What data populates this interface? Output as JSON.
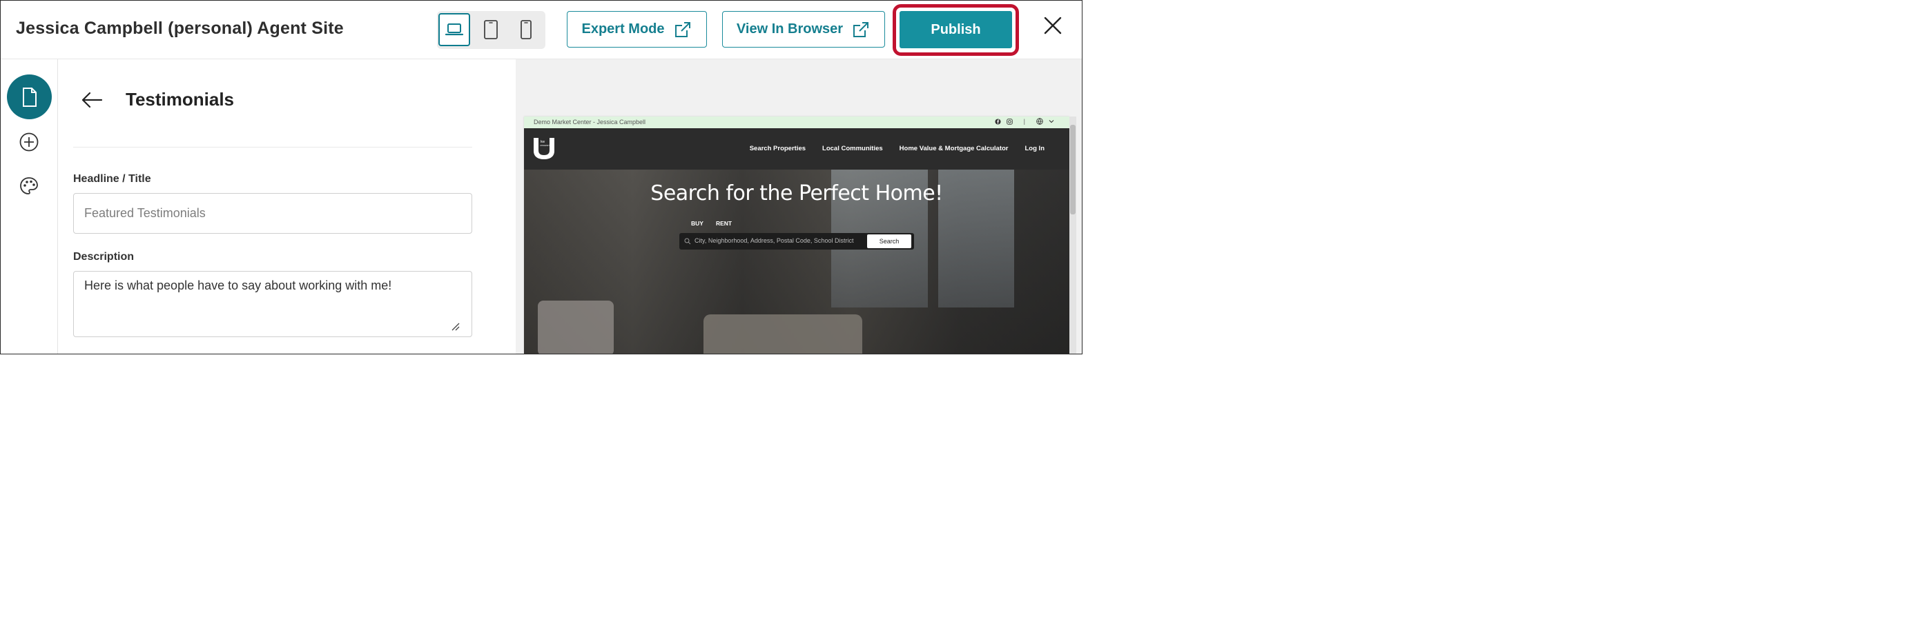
{
  "header": {
    "site_title": "Jessica Campbell (personal) Agent Site",
    "expert_mode_label": "Expert Mode",
    "view_in_browser_label": "View In Browser",
    "publish_label": "Publish",
    "device_modes": [
      "desktop",
      "tablet",
      "mobile"
    ],
    "active_device": "desktop"
  },
  "rail": {
    "items": [
      {
        "icon": "page-icon",
        "active": true
      },
      {
        "icon": "add-circle-icon",
        "active": false
      },
      {
        "icon": "palette-icon",
        "active": false
      }
    ]
  },
  "panel": {
    "title": "Testimonials",
    "headline_label": "Headline / Title",
    "headline_placeholder": "Featured Testimonials",
    "headline_value": "",
    "description_label": "Description",
    "description_value": "Here is what people have to say about working with me!"
  },
  "preview": {
    "utility_text": "Demo Market Center - Jessica Campbell",
    "nav": [
      "Search Properties",
      "Local Communities",
      "Home Value & Mortgage Calculator",
      "Log In"
    ],
    "hero_title": "Search for the Perfect Home!",
    "tabs": [
      "BUY",
      "RENT"
    ],
    "search_placeholder": "City, Neighborhood, Address, Postal Code, School District",
    "search_button": "Search"
  },
  "colors": {
    "accent": "#16909f",
    "accent_dark": "#0f6f7e",
    "highlight_ring": "#c1122f"
  }
}
